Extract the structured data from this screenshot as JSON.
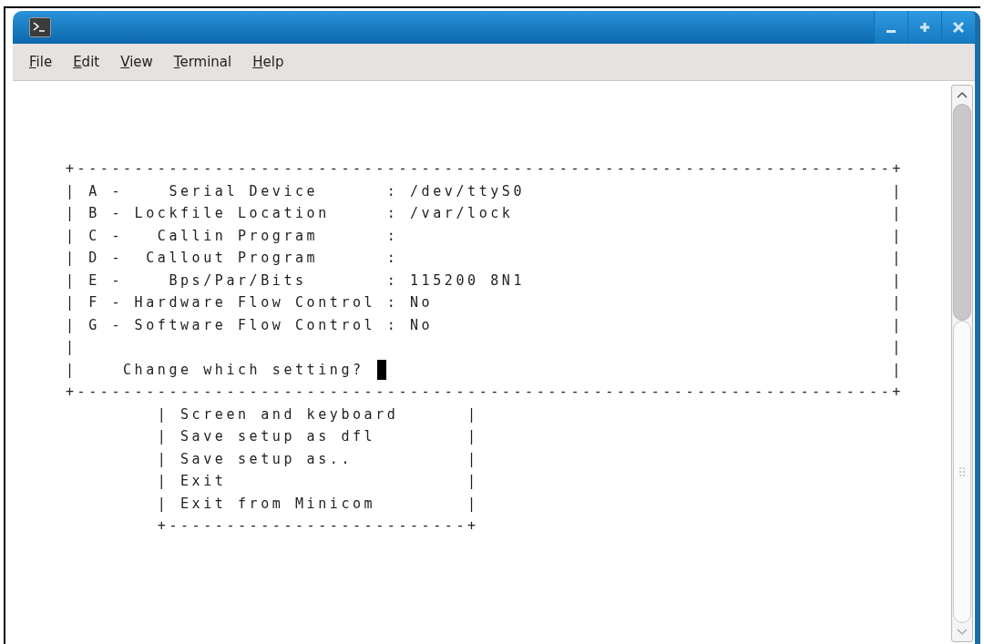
{
  "window": {
    "controls": [
      {
        "kind": "minimize"
      },
      {
        "kind": "maximize"
      },
      {
        "kind": "close"
      }
    ]
  },
  "menu": [
    {
      "label": "File"
    },
    {
      "label": "Edit"
    },
    {
      "label": "View"
    },
    {
      "label": "Terminal"
    },
    {
      "label": "Help"
    }
  ],
  "settings_box": {
    "top": "+-----------------------------------------------------------------------+",
    "rows": [
      {
        "text": "| A -    Serial Device      : /dev/ttyS0",
        "right": "|",
        "cursor": false
      },
      {
        "text": "| B - Lockfile Location     : /var/lock",
        "right": "|",
        "cursor": false
      },
      {
        "text": "| C -   Callin Program      :",
        "right": "|",
        "cursor": false
      },
      {
        "text": "| D -  Callout Program      :",
        "right": "|",
        "cursor": false
      },
      {
        "text": "| E -    Bps/Par/Bits       : 115200 8N1",
        "right": "|",
        "cursor": false
      },
      {
        "text": "| F - Hardware Flow Control : No",
        "right": "|",
        "cursor": false
      },
      {
        "text": "| G - Software Flow Control : No",
        "right": "|",
        "cursor": false
      },
      {
        "text": "|",
        "right": "|",
        "cursor": false
      },
      {
        "text": "|    Change which setting?",
        "right": "|",
        "cursor": true
      }
    ],
    "bottom": "+-----------------------------------------------------------------------+"
  },
  "menu_box": {
    "rows": [
      {
        "text": "| Screen and keyboard",
        "right": "|"
      },
      {
        "text": "| Save setup as dfl",
        "right": "|"
      },
      {
        "text": "| Save setup as..",
        "right": "|"
      },
      {
        "text": "| Exit",
        "right": "|"
      },
      {
        "text": "| Exit from Minicom",
        "right": "|"
      }
    ],
    "bottom": "+--------------------------+"
  }
}
